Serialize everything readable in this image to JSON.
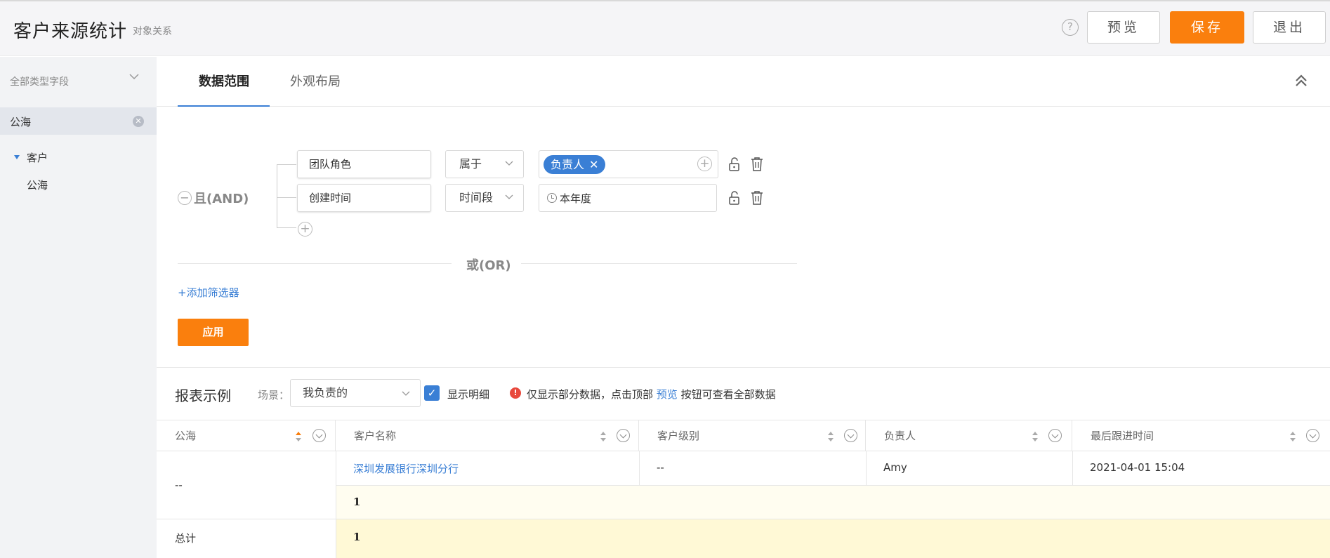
{
  "header": {
    "title": "客户来源统计",
    "subtitle": "对象关系",
    "help_icon": "?",
    "preview_label": "预览",
    "save_label": "保存",
    "exit_label": "退出"
  },
  "sidebar": {
    "field_type_label": "全部类型字段",
    "selected_item": "公海",
    "tree": {
      "parent": "客户",
      "child": "公海"
    }
  },
  "tabs": [
    {
      "label": "数据范围",
      "active": true
    },
    {
      "label": "外观布局",
      "active": false
    }
  ],
  "filter": {
    "and_label": "且(AND)",
    "or_label": "或(OR)",
    "conditions": [
      {
        "field": "团队角色",
        "operator": "属于",
        "value_tag": "负责人"
      },
      {
        "field": "创建时间",
        "operator": "时间段",
        "value_text": "本年度"
      }
    ],
    "add_filter_label": "+添加筛选器",
    "apply_label": "应用"
  },
  "report": {
    "title": "报表示例",
    "scene_label": "场景：",
    "scene_value": "我负责的",
    "show_detail_label": "显示明细",
    "show_detail_checked": true,
    "notice_prefix": "仅显示部分数据，点击顶部",
    "notice_link": "预览",
    "notice_suffix": "按钮可查看全部数据",
    "columns": [
      "公海",
      "客户名称",
      "客户级别",
      "负责人",
      "最后跟进时间"
    ],
    "group_value": "--",
    "row": {
      "customer_name": "深圳发展银行深圳分行",
      "level": "--",
      "owner": "Amy",
      "last_follow": "2021-04-01 15:04"
    },
    "subtotal": "1",
    "total_label": "总计",
    "total": "1"
  },
  "colors": {
    "accent_orange": "#fa7f0d",
    "accent_blue": "#3a7fd5",
    "subtotal_bg": "#fffdf0",
    "total_bg": "#fff9d6"
  }
}
